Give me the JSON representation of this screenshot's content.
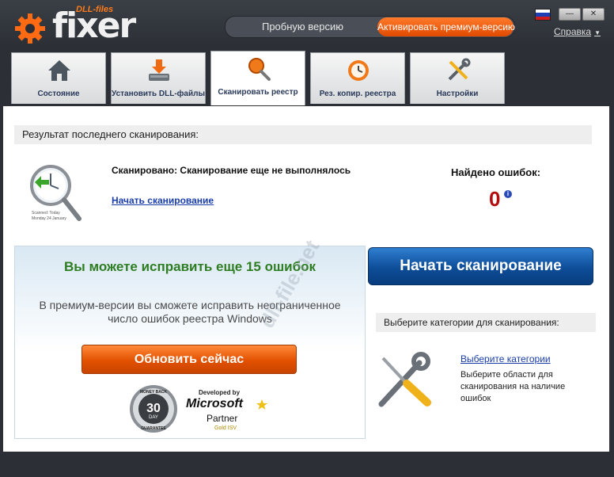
{
  "app": {
    "logo_small": "DLL-files",
    "logo_big": "fixer"
  },
  "header": {
    "trial_label": "Пробную версию",
    "premium_label": "Активировать премиум-версию",
    "help_label": "Справка",
    "minimize_label": "—",
    "close_label": "✕"
  },
  "tabs": [
    {
      "label": "Состояние",
      "icon": "home-icon"
    },
    {
      "label": "Установить DLL-файлы",
      "icon": "download-disk-icon"
    },
    {
      "label": "Сканировать реестр",
      "icon": "magnifier-icon",
      "active": true
    },
    {
      "label": "Рез. копир. реестра",
      "icon": "backup-clock-icon"
    },
    {
      "label": "Настройки",
      "icon": "tools-icon"
    }
  ],
  "last_scan": {
    "header": "Результат последнего сканирования:",
    "scanned_text": "Сканировано: Сканирование еще не выполнялось",
    "start_link": "Начать сканирование",
    "icon_caption_1": "Scanned: Today",
    "icon_caption_2": "Monday 24 January",
    "errors_label": "Найдено ошибок:",
    "errors_value": "0",
    "info_glyph": "i"
  },
  "promo": {
    "title": "Вы можете исправить еще 15 ошибок",
    "text": "В премиум-версии вы сможете исправить неограниченное число ошибок реестра Windows",
    "button": "Обновить сейчас",
    "badge_top": "MONEY BACK",
    "badge_number": "30",
    "badge_day": "DAY",
    "badge_bottom": "GUARANTEE",
    "ms_developed": "Developed by",
    "ms_name": "Microsoft",
    "ms_partner": "Partner",
    "ms_gold_word": "Gold",
    "ms_isv": "ISV"
  },
  "scan": {
    "button": "Начать сканирование",
    "categories_header": "Выберите категории для сканирования:",
    "categories_link": "Выберите категории",
    "categories_desc": "Выберите области для сканирования на наличие ошибок"
  },
  "watermark": "dll-file.net",
  "colors": {
    "accent_orange": "#e25100",
    "scan_blue": "#0e4d98",
    "promo_green": "#2e7d22",
    "error_red": "#b30d0d"
  }
}
